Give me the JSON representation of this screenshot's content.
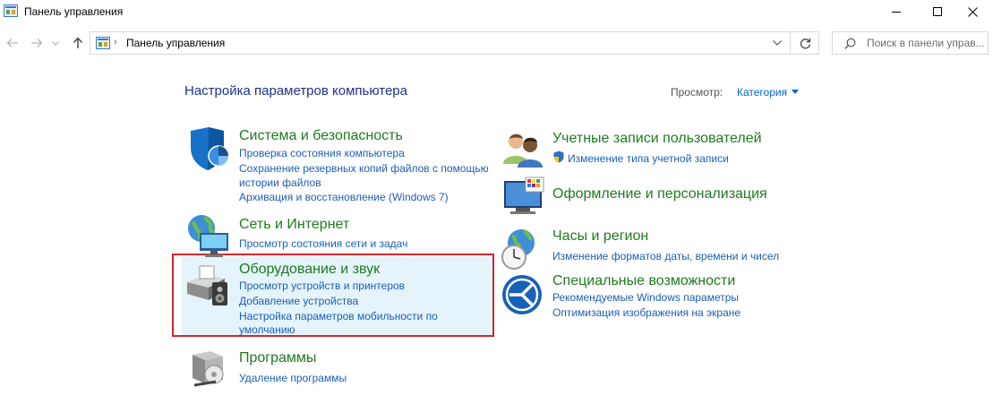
{
  "window": {
    "title": "Панель управления"
  },
  "navigation": {
    "address_separator": "›",
    "address_text": "Панель управления",
    "search_placeholder": "Поиск в панели управ..."
  },
  "content": {
    "page_title": "Настройка параметров компьютера",
    "view_by_label": "Просмотр:",
    "view_by_value": "Категория"
  },
  "categories": [
    {
      "title": "Система и безопасность",
      "links": [
        "Проверка состояния компьютера",
        "Сохранение резервных копий файлов с помощью",
        "истории файлов",
        "Архивация и восстановление (Windows 7)"
      ]
    },
    {
      "title": "Сеть и Интернет",
      "links": [
        "Просмотр состояния сети и задач"
      ]
    },
    {
      "title": "Оборудование и звук",
      "highlighted": true,
      "links": [
        "Просмотр устройств и принтеров",
        "Добавление устройства",
        "Настройка параметров мобильности по",
        "умолчанию"
      ]
    },
    {
      "title": "Программы",
      "links": [
        "Удаление программы"
      ]
    },
    {
      "title": "Учетные записи пользователей",
      "links": [
        "Изменение типа учетной записи"
      ]
    },
    {
      "title": "Оформление и персонализация",
      "links": []
    },
    {
      "title": "Часы и регион",
      "links": [
        "Изменение форматов даты, времени и чисел"
      ]
    },
    {
      "title": "Специальные возможности",
      "links": [
        "Рекомендуемые Windows параметры",
        "Оптимизация изображения на экране"
      ]
    }
  ],
  "colors": {
    "category_title": "#1e7b1e",
    "link": "#1a5fb4",
    "page_title": "#1e3287",
    "highlight_background": "#e5f3fb",
    "highlight_border": "#d2262c"
  },
  "icons": {
    "app": "control-panel-icon",
    "back": "arrow-left-icon",
    "forward": "arrow-right-icon",
    "up": "arrow-up-icon",
    "refresh": "refresh-icon",
    "search": "search-icon"
  }
}
